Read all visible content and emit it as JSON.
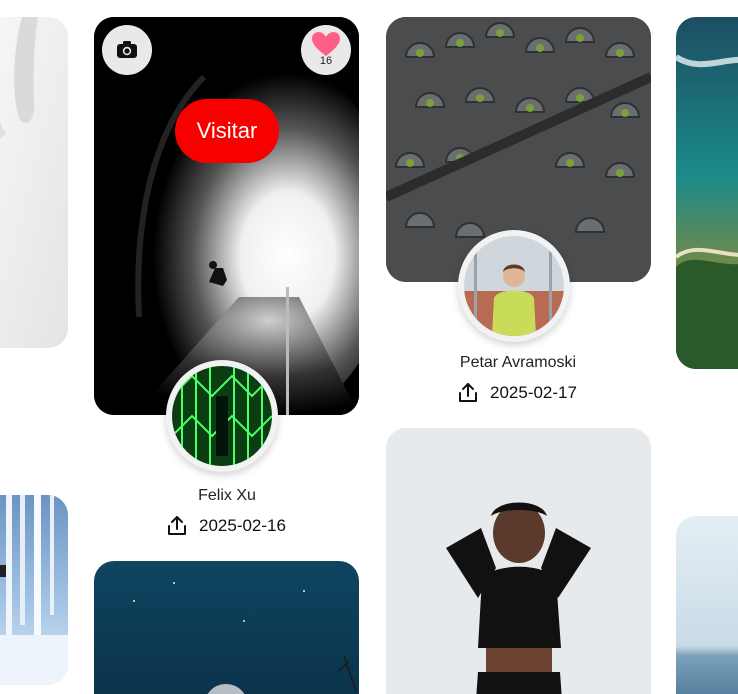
{
  "cards": {
    "featured": {
      "visit_label": "Visitar",
      "likes": "16",
      "author": "Felix Xu",
      "date": "2025-02-16"
    },
    "second": {
      "author": "Petar Avramoski",
      "date": "2025-02-17"
    }
  },
  "colors": {
    "visit_button": "#f60000",
    "heart": "#ff5f87"
  },
  "icons": {
    "camera": "camera-icon",
    "heart": "heart-icon",
    "upload": "upload-icon"
  }
}
